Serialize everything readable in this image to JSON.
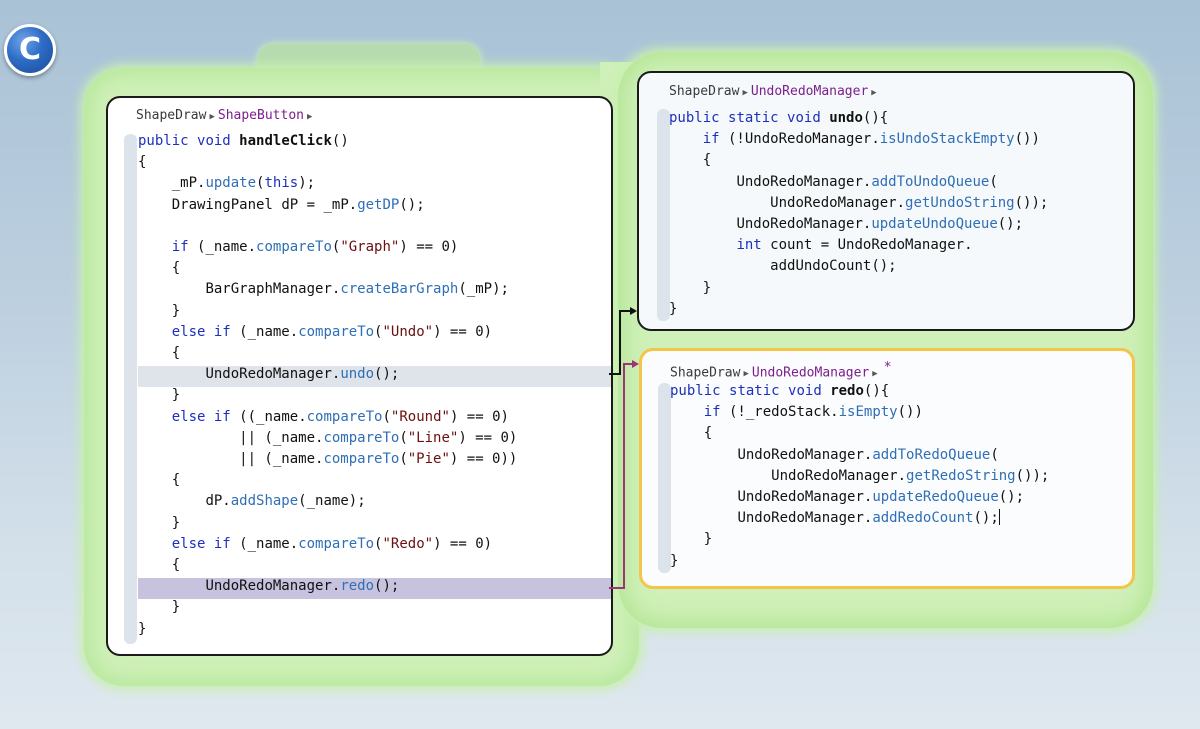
{
  "badge": {
    "label": "C"
  },
  "left": {
    "breadcrumb": {
      "root": "ShapeDraw",
      "leaf": "ShapeButton"
    },
    "lines": [
      {
        "t": "public void handleClick()"
      },
      {
        "t": "{"
      },
      {
        "t": "    _mP.update(this);"
      },
      {
        "t": "    DrawingPanel dP = _mP.getDP();"
      },
      {
        "t": ""
      },
      {
        "t": "    if (_name.compareTo(\"Graph\") == 0)"
      },
      {
        "t": "    {"
      },
      {
        "t": "        BarGraphManager.createBarGraph(_mP);"
      },
      {
        "t": "    }"
      },
      {
        "t": "    else if (_name.compareTo(\"Undo\") == 0)"
      },
      {
        "t": "    {"
      },
      {
        "t": "        UndoRedoManager.undo();"
      },
      {
        "t": "    }"
      },
      {
        "t": "    else if ((_name.compareTo(\"Round\") == 0)"
      },
      {
        "t": "            || (_name.compareTo(\"Line\") == 0)"
      },
      {
        "t": "            || (_name.compareTo(\"Pie\") == 0))"
      },
      {
        "t": "    {"
      },
      {
        "t": "        dP.addShape(_name);"
      },
      {
        "t": "    }"
      },
      {
        "t": "    else if (_name.compareTo(\"Redo\") == 0)"
      },
      {
        "t": "    {"
      },
      {
        "t": "        UndoRedoManager.redo();"
      },
      {
        "t": "    }"
      },
      {
        "t": "}"
      }
    ]
  },
  "undo": {
    "breadcrumb": {
      "root": "ShapeDraw",
      "leaf": "UndoRedoManager"
    },
    "lines": [
      {
        "t": "public static void undo(){"
      },
      {
        "t": "    if (!UndoRedoManager.isUndoStackEmpty())"
      },
      {
        "t": "    {"
      },
      {
        "t": "        UndoRedoManager.addToUndoQueue("
      },
      {
        "t": "            UndoRedoManager.getUndoString());"
      },
      {
        "t": "        UndoRedoManager.updateUndoQueue();"
      },
      {
        "t": "        int count = UndoRedoManager."
      },
      {
        "t": "            addUndoCount();"
      },
      {
        "t": "    }"
      },
      {
        "t": "}"
      }
    ]
  },
  "redo": {
    "breadcrumb": {
      "root": "ShapeDraw",
      "leaf": "UndoRedoManager",
      "modified": "*"
    },
    "lines": [
      {
        "t": "public static void redo(){"
      },
      {
        "t": "    if (!_redoStack.isEmpty())"
      },
      {
        "t": "    {"
      },
      {
        "t": "        UndoRedoManager.addToRedoQueue("
      },
      {
        "t": "            UndoRedoManager.getRedoString());"
      },
      {
        "t": "        UndoRedoManager.updateRedoQueue();"
      },
      {
        "t": "        UndoRedoManager.addRedoCount();"
      },
      {
        "t": "    }"
      },
      {
        "t": "}"
      }
    ]
  },
  "colors": {
    "keyword": "#1d2fbe",
    "method": "#2f6fb5",
    "string": "#6b0f0f",
    "breadcrumb_leaf": "#7b1f8c",
    "active_bubble_border": "#f5c54a",
    "bundle_background": "#cff0b8",
    "undo_arrow": "#111111",
    "redo_arrow": "#a0327a"
  }
}
